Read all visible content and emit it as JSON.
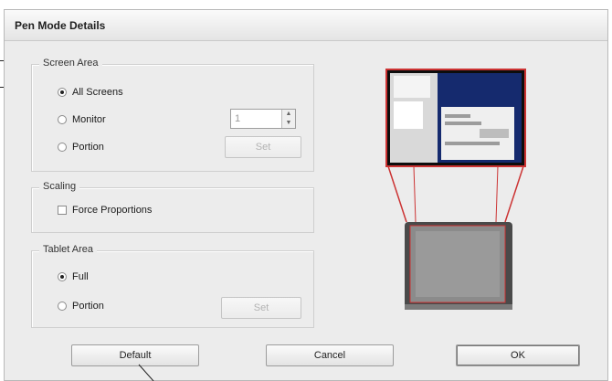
{
  "dialog": {
    "title": "Pen Mode Details"
  },
  "screen_area": {
    "legend": "Screen Area",
    "options": [
      {
        "label": "All Screens",
        "selected": true
      },
      {
        "label": "Monitor",
        "selected": false
      },
      {
        "label": "Portion",
        "selected": false
      }
    ],
    "monitor_value": "1",
    "set_label": "Set"
  },
  "scaling": {
    "legend": "Scaling",
    "force_proportions_label": "Force Proportions",
    "checked": false
  },
  "tablet_area": {
    "legend": "Tablet Area",
    "options": [
      {
        "label": "Full",
        "selected": true
      },
      {
        "label": "Portion",
        "selected": false
      }
    ],
    "set_label": "Set"
  },
  "buttons": {
    "default_label": "Default",
    "cancel_label": "Cancel",
    "ok_label": "OK"
  },
  "colors": {
    "mapping_lines": "#cc3333",
    "screen_desktop": "#152a6e",
    "tablet_active_area": "#8b8b8b"
  },
  "icons": [
    "spin-up-icon",
    "spin-down-icon",
    "screen-preview-icon",
    "tablet-preview-icon"
  ]
}
